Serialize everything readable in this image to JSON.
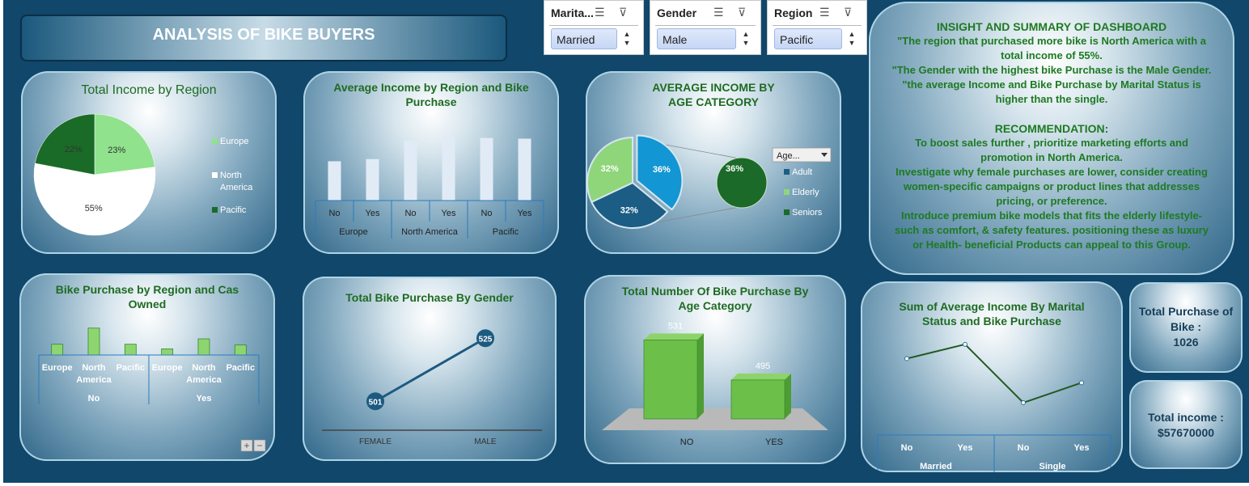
{
  "dashboard_title": "ANALYSIS OF BIKE BUYERS",
  "slicers": [
    {
      "header": "Marita...",
      "selected": "Married"
    },
    {
      "header": "Gender",
      "selected": "Male"
    },
    {
      "header": "Region",
      "selected": "Pacific"
    }
  ],
  "insight": {
    "heading": "INSIGHT AND SUMMARY OF DASHBOARD",
    "lines": [
      "\"The region that purchased more bike is North America with a total income of 55%.",
      "\"The Gender with the highest bike Purchase is the Male Gender.",
      "\"the average Income and Bike Purchase by Marital Status is higher than the single."
    ],
    "recommendation_heading": "RECOMMENDATION:",
    "recommendations": [
      "To boost sales further , prioritize marketing efforts and promotion in North America.",
      "Investigate why female purchases are lower, consider creating women-specific campaigns or product lines that addresses pricing, or preference.",
      "Introduce premium bike models that fits the elderly lifestyle- such as comfort, & safety features. positioning these as luxury or Health- beneficial Products can appeal to this Group."
    ]
  },
  "kpis": {
    "total_purchase_label": "Total Purchase of Bike :",
    "total_purchase_value": "1026",
    "total_income_label": "Total income :",
    "total_income_value": "$57670000"
  },
  "chart_data": [
    {
      "id": "income_by_region",
      "type": "pie",
      "title": "Total Income by Region",
      "slices": [
        {
          "label": "Europe",
          "value": 23,
          "display": "23%",
          "color": "#90e28c"
        },
        {
          "label": "North America",
          "value": 55,
          "display": "55%",
          "color": "#ffffff"
        },
        {
          "label": "Pacific",
          "value": 22,
          "display": "22%",
          "color": "#1a6b28"
        }
      ]
    },
    {
      "id": "avg_income_region_purchase",
      "type": "bar",
      "title": "Average Income by Region and Bike Purchase",
      "groups": [
        "Europe",
        "North America",
        "Pacific"
      ],
      "categories": [
        "No",
        "Yes",
        "No",
        "Yes",
        "No",
        "Yes"
      ],
      "values": [
        54,
        57,
        82,
        88,
        86,
        85
      ],
      "bar_color": "#e1ebf6"
    },
    {
      "id": "avg_income_age",
      "type": "pie",
      "title": "AVERAGE INCOME BY AGE CATEGORY",
      "slices": [
        {
          "label": "Adult",
          "value": 32,
          "display": "32%",
          "color": "#1b5d84"
        },
        {
          "label": "Elderly",
          "value": 32,
          "display": "32%",
          "color": "#8fd67a"
        },
        {
          "label": "Seniors",
          "value": 36,
          "display": "36%",
          "color": "#1b6a29"
        }
      ],
      "filter_label": "Age..."
    },
    {
      "id": "purchase_region_cars",
      "type": "bar",
      "title": "Bike Purchase by Region and  Cas Owned",
      "groups": [
        "No",
        "Yes"
      ],
      "categories": [
        "Europe",
        "North America",
        "Pacific",
        "Europe",
        "North America",
        "Pacific"
      ],
      "values": [
        14,
        35,
        14,
        8,
        21,
        13
      ],
      "bar_color": "#8fd56f",
      "buttons": [
        "+",
        "−"
      ]
    },
    {
      "id": "purchase_by_gender",
      "type": "line",
      "title": "Total  Bike Purchase By Gender",
      "categories": [
        "FEMALE",
        "MALE"
      ],
      "values": [
        501,
        525
      ],
      "ylim": [
        490,
        530
      ]
    },
    {
      "id": "purchase_by_age",
      "type": "bar",
      "title": "Total Number Of Bike Purchase By Age Category",
      "categories": [
        "NO",
        "YES"
      ],
      "values": [
        531,
        495
      ],
      "ylim": [
        460,
        540
      ],
      "bar_color": "#6cc04a"
    },
    {
      "id": "avg_income_marital",
      "type": "line",
      "title": "Sum of Average Income By Marital Status and Bike Purchase",
      "groups": [
        "Married",
        "Single"
      ],
      "categories": [
        "No",
        "Yes",
        "No",
        "Yes"
      ],
      "values": [
        62,
        82,
        0,
        28
      ],
      "ylim": [
        0,
        100
      ]
    }
  ]
}
